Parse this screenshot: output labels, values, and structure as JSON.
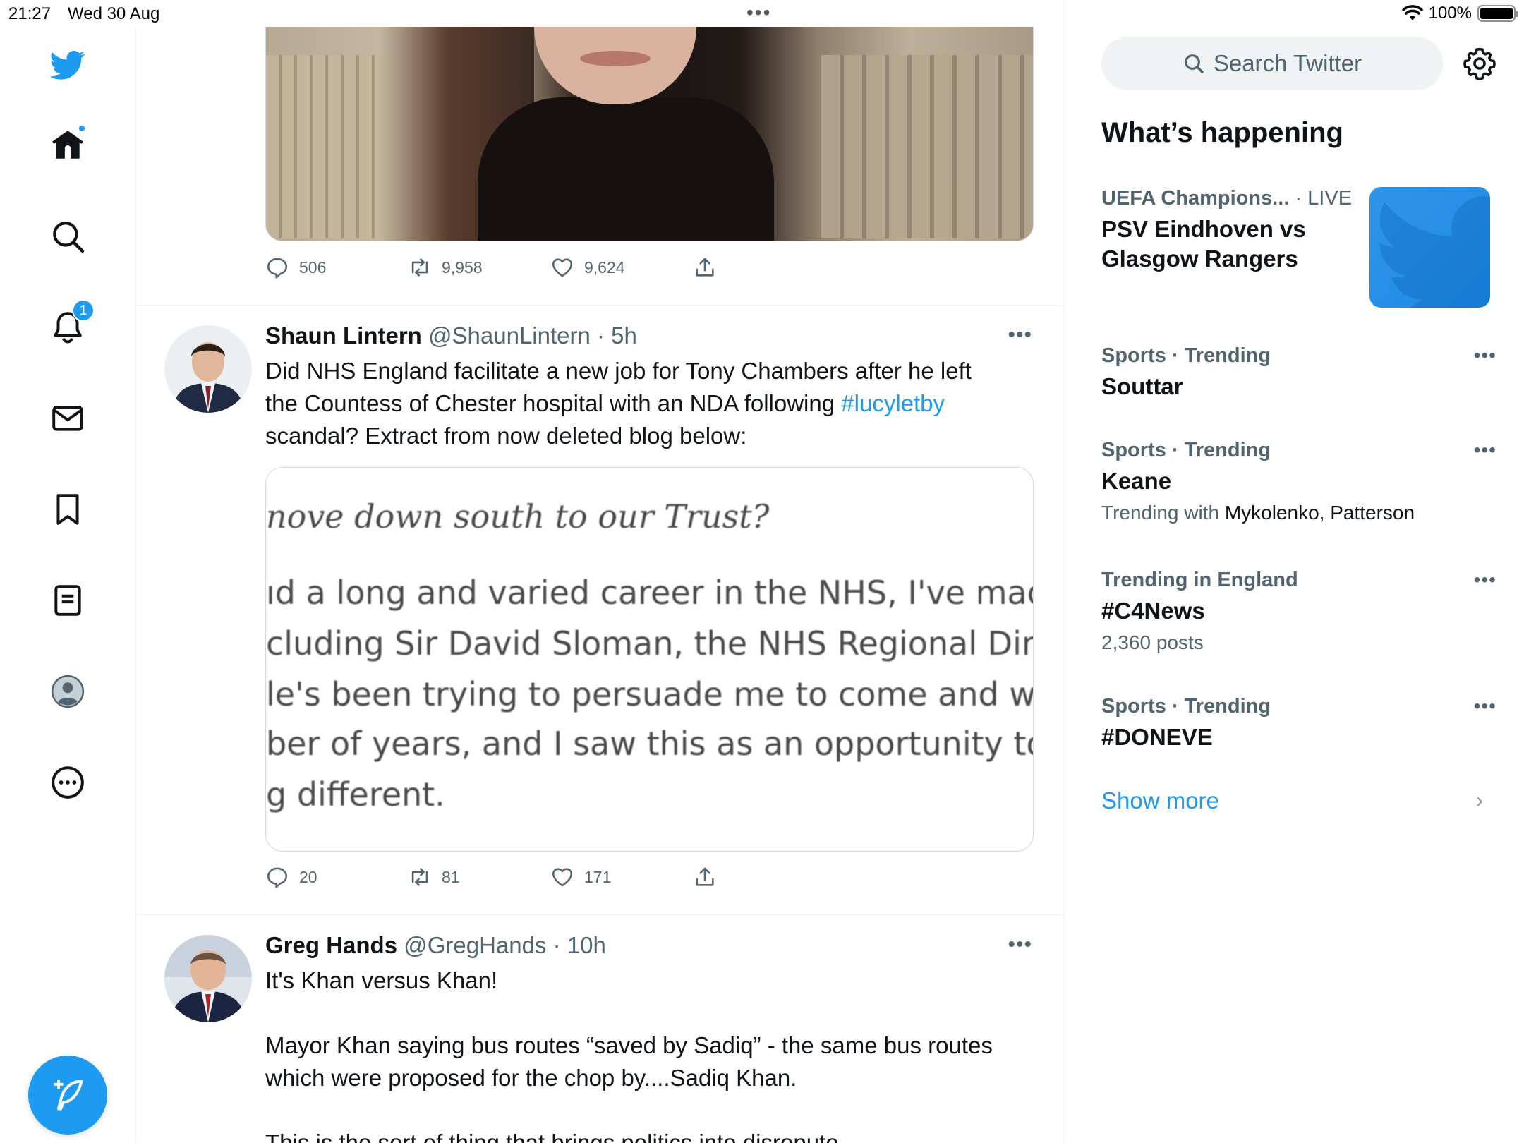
{
  "status_bar": {
    "time": "21:27",
    "date": "Wed 30 Aug",
    "center_indicator": "•••",
    "battery": "100%",
    "battery_level_fraction": 1.0
  },
  "nav": {
    "items": [
      "twitter-logo",
      "home-icon",
      "search-icon",
      "notifications-icon",
      "messages-icon",
      "bookmarks-icon",
      "lists-icon",
      "profile-icon",
      "more-icon"
    ],
    "notifications_badge": "1",
    "accent_color": "#1d9bf0"
  },
  "timeline": {
    "top_tweet_stats": {
      "replies": "506",
      "retweets": "9,958",
      "likes": "9,624"
    },
    "tweets": [
      {
        "name": "Shaun Lintern",
        "handle": "@ShaunLintern",
        "time": "· 5h",
        "text_line1": "Did NHS England facilitate a new job for Tony Chambers after he left",
        "text_line2_pre": "the Countess of Chester hospital with an NDA following ",
        "hashtag": "#lucyletby",
        "text_line3": "scandal? Extract from now deleted blog below:",
        "image_lines": [
          "nove down south to our Trust?",
          "ıd a long and varied career in the NHS, I've made lo",
          "cluding Sir David Sloman, the NHS Regional Direct",
          "le's been trying to persuade me to come and work",
          "ber of years, and I saw this as an opportunity to do",
          "g different."
        ],
        "replies": "20",
        "retweets": "81",
        "likes": "171"
      },
      {
        "name": "Greg Hands",
        "handle": "@GregHands",
        "time": "· 10h",
        "text_line1": "It's Khan versus Khan!",
        "text_para2_line1": "Mayor Khan saying bus routes “saved by Sadiq” - the same bus routes",
        "text_para2_line2": "which were proposed for the chop by....Sadiq Khan.",
        "text_para3_line1": "This is the sort of thing that brings politics into disrepute."
      }
    ]
  },
  "sidebar": {
    "search_placeholder": "Search Twitter",
    "section_title": "What’s happening",
    "trends": [
      {
        "category": "UEFA Champions...",
        "suffix": " · LIVE",
        "title_line1": "PSV Eindhoven vs",
        "title_line2": "Glasgow Rangers"
      },
      {
        "category": "Sports · Trending",
        "title": "Souttar"
      },
      {
        "category": "Sports · Trending",
        "title": "Keane",
        "sub_prefix": "Trending with ",
        "sub_names": "Mykolenko, Patterson"
      },
      {
        "category": "Trending in England",
        "title": "#C4News",
        "sub": "2,360 posts"
      },
      {
        "category": "Sports · Trending",
        "title": "#DONEVE"
      }
    ],
    "show_more": "Show more",
    "more_glyph": "•••",
    "chevron": "›"
  }
}
